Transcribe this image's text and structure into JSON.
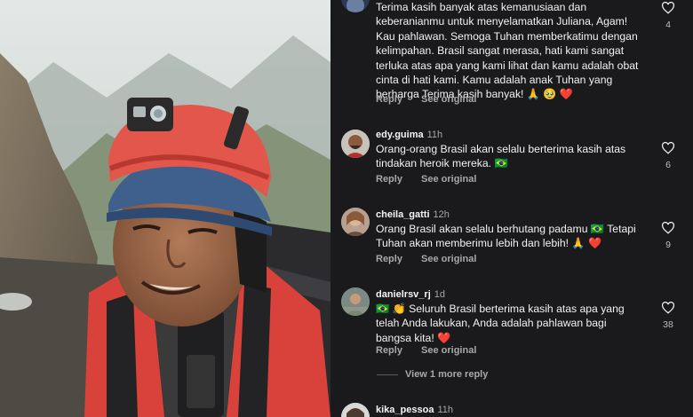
{
  "comments": [
    {
      "username": "",
      "time": "",
      "text": "Terima kasih banyak atas kemanusiaan dan keberanianmu untuk menyelamatkan Juliana, Agam! Kau pahlawan. Semoga Tuhan memberkatimu dengan kelimpahan. Brasil sangat merasa, hati kami sangat terluka atas apa yang kami lihat dan kamu adalah obat cinta di hati kami. Kamu adalah anak Tuhan yang berharga Terima kasih banyak! 🙏 🥹 ❤️",
      "reply_label": "Reply",
      "translation_label": "See original",
      "like_count": "4"
    },
    {
      "username": "edy.guima",
      "time": "11h",
      "text": "Orang-orang Brasil akan selalu berterima kasih atas tindakan heroik mereka. 🇧🇷",
      "reply_label": "Reply",
      "translation_label": "See original",
      "like_count": "6"
    },
    {
      "username": "cheila_gatti",
      "time": "12h",
      "text": "Orang Brasil akan selalu berhutang padamu 🇧🇷 Tetapi Tuhan akan memberimu lebih dan lebih! 🙏 ❤️",
      "reply_label": "Reply",
      "translation_label": "See original",
      "like_count": "9"
    },
    {
      "username": "danielrsv_rj",
      "time": "1d",
      "text": "🇧🇷 👏 Seluruh Brasil berterima kasih atas apa yang telah Anda lakukan, Anda adalah pahlawan bagi bangsa kita! ❤️",
      "reply_label": "Reply",
      "translation_label": "See original",
      "like_count": "38"
    },
    {
      "username": "kika_pessoa",
      "time": "11h",
      "text": "",
      "reply_label": "",
      "translation_label": "",
      "like_count": ""
    }
  ],
  "view_more_replies": "View 1 more reply",
  "colors": {
    "background": "#1a1a1c",
    "primary_text": "#f2f2f2",
    "secondary_text": "#a8a8a8",
    "heart_icon": "#f2f2f2"
  },
  "icons": [
    "heart-outline-icon",
    "avatar",
    "brazil-flag-emoji",
    "pray-emoji",
    "heart-emoji",
    "clap-emoji"
  ]
}
